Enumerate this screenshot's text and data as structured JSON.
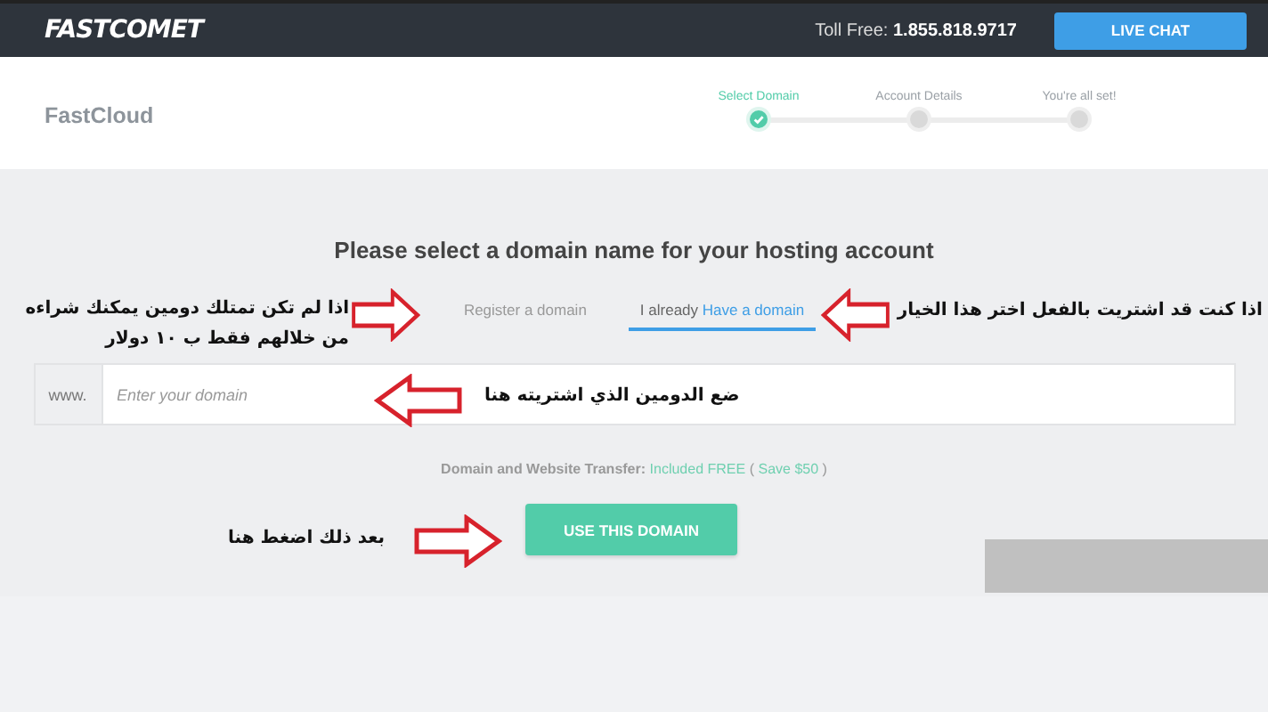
{
  "header": {
    "logo": "FASTCOMET",
    "toll_label": "Toll Free:",
    "toll_number": "1.855.818.9717",
    "chat_button": "LIVE CHAT"
  },
  "plan": {
    "name": "FastCloud"
  },
  "steps": [
    {
      "label": "Select Domain",
      "selected": true
    },
    {
      "label": "Account Details",
      "selected": false
    },
    {
      "label": "You're all set!",
      "selected": false
    }
  ],
  "heading": "Please select a domain name for your hosting account",
  "tabs": [
    {
      "label": "Register a domain",
      "selected": false
    },
    {
      "prefix": "I already",
      "label": "Have a domain",
      "selected": true
    }
  ],
  "domain_field": {
    "prefix": "www.",
    "placeholder": "Enter your domain"
  },
  "transfer_note": [
    {
      "text": "Domain and Website Transfer:",
      "kind": "label"
    },
    {
      "text": "Included FREE",
      "kind": "highlight"
    },
    {
      "text": "(",
      "kind": "plain"
    },
    {
      "text": "Save $50",
      "kind": "highlight"
    },
    {
      "text": ")",
      "kind": "plain"
    }
  ],
  "submit_button": "USE THIS DOMAIN",
  "annotations": [
    {
      "text": "اذا كنت قد اشتريت بالفعل اختر هذا الخيار",
      "kind": "left"
    },
    {
      "text": "اذا لم تكن تمتلك دومين يمكنك شراءه من خلالهم فقط ب ١٠ دولار",
      "kind": "right"
    },
    {
      "text": "ضع الدومين الذي اشتريته هنا",
      "kind": "left"
    },
    {
      "text": "بعد ذلك اضغط هنا",
      "kind": "right"
    }
  ]
}
